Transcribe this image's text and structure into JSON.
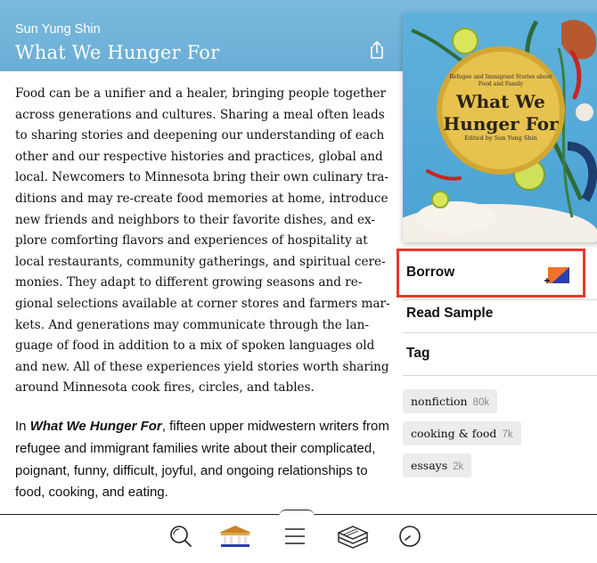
{
  "header": {
    "author": "Sun Yung Shin",
    "title": "What We Hunger For"
  },
  "description": {
    "lines": [
      "Food can be a unifier and a healer, bringing people together",
      "across generations and cultures. Sharing a meal often leads",
      "to sharing stories and deepening our understanding of each",
      "other and our respective histories and practices, global and",
      "local. Newcomers to Minnesota bring their own culinary tra-",
      "ditions and may re-create food memories at home, introduce",
      "new friends and neighbors to their favorite dishes, and ex-",
      "plore comforting flavors and experiences of hospitality at",
      "local restaurants, community gatherings, and spiritual cere-",
      "monies. They adapt to different growing seasons and re-",
      "gional selections available at corner stores and farmers mar-",
      "kets. And generations may communicate through the lan-",
      "guage of food in addition to a mix of spoken languages old",
      "and new. All of these experiences yield stories worth sharing",
      "around Minnesota cook fires, circles, and tables."
    ],
    "para2_prefix": "In ",
    "para2_title": "What We Hunger For",
    "para2_line1_rest": ", fifteen upper midwestern writers from",
    "para2_lines": [
      "refugee and immigrant families write about their complicated,",
      "poignant, funny, difficult, joyful, and ongoing relationships to",
      "food, cooking, and eating."
    ]
  },
  "cover": {
    "subtitle": "Refugee and Immigrant Stories about Food and Family",
    "title_line1": "What We",
    "title_line2": "Hunger For",
    "editor": "Edited by Sun Yung Shin"
  },
  "actions": {
    "borrow": "Borrow",
    "read_sample": "Read Sample",
    "tag": "Tag"
  },
  "tags": [
    {
      "label": "nonfiction",
      "count": "80k"
    },
    {
      "label": "cooking & food",
      "count": "7k"
    },
    {
      "label": "essays",
      "count": "2k"
    }
  ],
  "nav": {
    "icons": [
      "search-icon",
      "library-icon",
      "menu-icon",
      "books-icon",
      "clock-icon"
    ]
  },
  "colors": {
    "header": "#6aaed6",
    "highlight": "#e8382b",
    "cover_bg": "#4aa3d4"
  }
}
